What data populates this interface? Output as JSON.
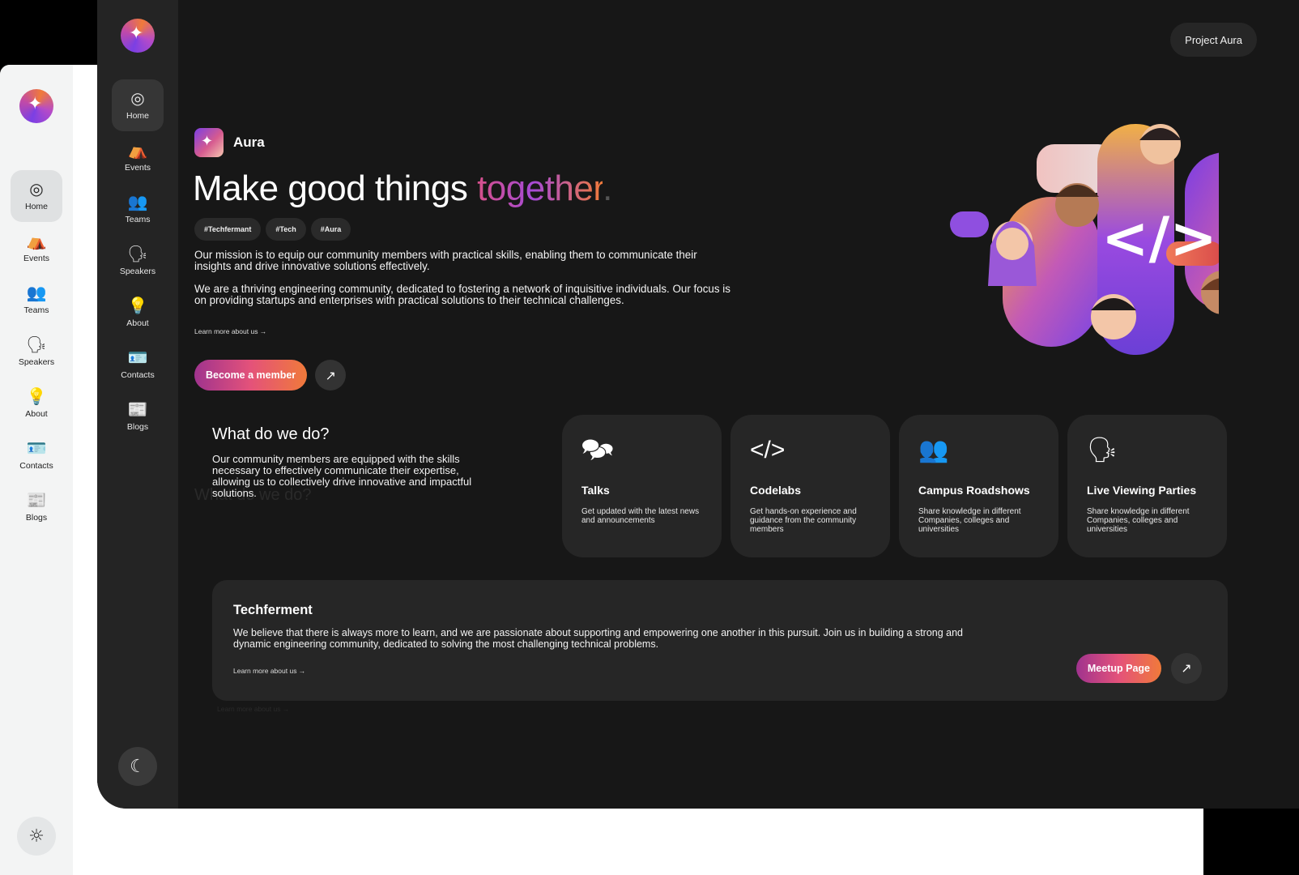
{
  "light_sidebar": {
    "items": [
      {
        "label": "Home",
        "icon": "◎"
      },
      {
        "label": "Events",
        "icon": "⛺"
      },
      {
        "label": "Teams",
        "icon": "👥"
      },
      {
        "label": "Speakers",
        "icon": "🗣"
      },
      {
        "label": "About",
        "icon": "💡"
      },
      {
        "label": "Contacts",
        "icon": "🪪"
      },
      {
        "label": "Blogs",
        "icon": "📰"
      }
    ],
    "theme_icon": "☼"
  },
  "dark_sidebar": {
    "items": [
      {
        "label": "Home",
        "icon": "◎"
      },
      {
        "label": "Events",
        "icon": "⛺"
      },
      {
        "label": "Teams",
        "icon": "👥"
      },
      {
        "label": "Speakers",
        "icon": "🗣"
      },
      {
        "label": "About",
        "icon": "💡"
      },
      {
        "label": "Contacts",
        "icon": "🪪"
      },
      {
        "label": "Blogs",
        "icon": "📰"
      }
    ],
    "theme_icon": "☾"
  },
  "header": {
    "project_label": "Project Aura"
  },
  "brand": {
    "name": "Aura"
  },
  "hero": {
    "headline_main": "Make good things ",
    "headline_accent": "together",
    "headline_dot": ".",
    "tags": [
      "#Techfermant",
      "#Tech",
      "#Aura"
    ],
    "mission_p1": "Our mission is to equip our community members with practical skills, enabling them to communicate their insights and drive innovative solutions effectively.",
    "mission_p2": "We are a thriving engineering community, dedicated to fostering a network of inquisitive individuals. Our focus is on providing startups and enterprises with practical solutions to their technical challenges.",
    "learn_more": "Learn more about us →",
    "cta_label": "Become a member",
    "cta_arrow": "↗"
  },
  "what": {
    "title": "What do we do?",
    "ghost_title": "What do we do?",
    "description": "Our community members are equipped with the skills necessary to effectively communicate their expertise, allowing us to collectively drive innovative and impactful solutions."
  },
  "cards": [
    {
      "icon": "🗫",
      "title": "Talks",
      "desc": "Get updated with the latest news and announcements"
    },
    {
      "icon": "</>",
      "title": "Codelabs",
      "desc": "Get hands-on experience and guidance from the community members"
    },
    {
      "icon": "👥",
      "title": "Campus Roadshows",
      "desc": "Share knowledge in different Companies, colleges and universities"
    },
    {
      "icon": "🗣",
      "title": "Live Viewing Parties",
      "desc": "Share knowledge in different Companies, colleges and universities"
    }
  ],
  "techferment": {
    "title": "Techferment",
    "description": "We believe that there is always more to learn, and we are passionate about supporting and empowering one another in this pursuit. Join us in building a strong and dynamic engineering community, dedicated to solving the most challenging technical problems.",
    "learn_more": "Learn more about us →",
    "ghost_learn_more": "Learn more about us →",
    "button_label": "Meetup Page",
    "button_arrow": "↗"
  },
  "illustration": {
    "code_glyph": "</>"
  }
}
